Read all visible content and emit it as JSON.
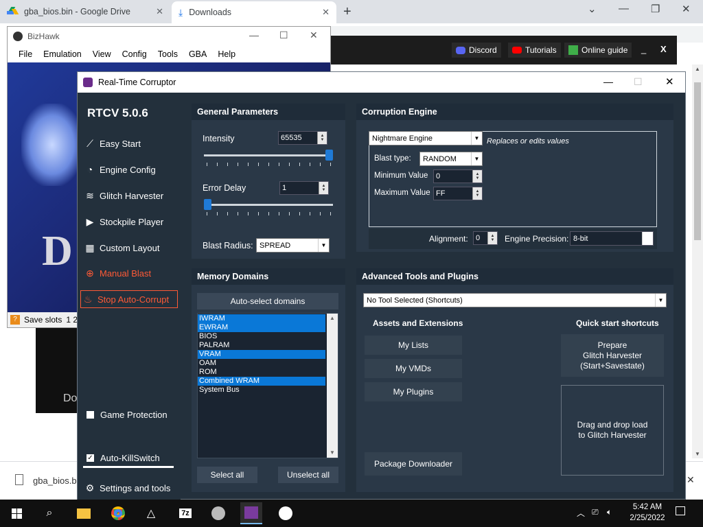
{
  "chrome": {
    "tab1_title": "gba_bios.bin - Google Drive",
    "tab2_title": "Downloads",
    "tab_close": "✕",
    "new_tab": "+",
    "minimize": "⌄",
    "restore": "—",
    "maximize": "❐",
    "close": "✕"
  },
  "banner": {
    "discord": "Discord",
    "tutorials": "Tutorials",
    "online_guide": "Online guide",
    "minimize": "_",
    "close": "X"
  },
  "downloads_bar": {
    "file_name": "gba_bios.bi"
  },
  "background_game": {
    "partial_text": "Do"
  },
  "bizhawk": {
    "title": "BizHawk",
    "menu": [
      "File",
      "Emulation",
      "View",
      "Config",
      "Tools",
      "GBA",
      "Help"
    ],
    "status_label": "Save slots",
    "status_slots": "1  2",
    "game_letter": "D"
  },
  "rtc": {
    "title": "Real-Time Corruptor",
    "version": "RTCV 5.0.6",
    "sidebar": {
      "easy_start": "Easy Start",
      "engine_config": "Engine Config",
      "glitch_harvester": "Glitch Harvester",
      "stockpile_player": "Stockpile Player",
      "custom_layout": "Custom Layout",
      "manual_blast": "Manual Blast",
      "stop_auto_corrupt": "Stop Auto-Corrupt",
      "game_protection": "Game Protection",
      "auto_killswitch": "Auto-KillSwitch",
      "settings_and_tools": "Settings and tools"
    },
    "general": {
      "title": "General Parameters",
      "intensity_label": "Intensity",
      "intensity_value": "65535",
      "intensity_level": 1.0,
      "error_delay_label": "Error Delay",
      "error_delay_value": "1",
      "error_delay_level": 0.0,
      "blast_radius_label": "Blast Radius:",
      "blast_radius_value": "SPREAD"
    },
    "engine": {
      "title": "Corruption Engine",
      "engine_value": "Nightmare Engine",
      "engine_desc": "Replaces or edits values",
      "blast_type_label": "Blast type:",
      "blast_type_value": "RANDOM",
      "min_label": "Minimum Value",
      "min_value": "0",
      "max_label": "Maximum Value",
      "max_value": "FF",
      "alignment_label": "Alignment:",
      "alignment_value": "0",
      "precision_label": "Engine Precision:",
      "precision_value": "8-bit"
    },
    "memory": {
      "title": "Memory Domains",
      "auto_select": "Auto-select domains",
      "domains": [
        {
          "name": "IWRAM",
          "selected": true
        },
        {
          "name": "EWRAM",
          "selected": true
        },
        {
          "name": "BIOS",
          "selected": false
        },
        {
          "name": "PALRAM",
          "selected": false
        },
        {
          "name": "VRAM",
          "selected": true
        },
        {
          "name": "OAM",
          "selected": false
        },
        {
          "name": "ROM",
          "selected": false
        },
        {
          "name": "Combined WRAM",
          "selected": true
        },
        {
          "name": "System Bus",
          "selected": false
        }
      ],
      "select_all": "Select all",
      "unselect_all": "Unselect all"
    },
    "advanced": {
      "title": "Advanced Tools and Plugins",
      "tool_select": "No Tool Selected (Shortcuts)",
      "assets_title": "Assets and Extensions",
      "my_lists": "My Lists",
      "my_vmds": "My VMDs",
      "my_plugins": "My Plugins",
      "package_downloader": "Package Downloader",
      "quick_title": "Quick start shortcuts",
      "prepare_gh": "Prepare\nGlitch Harvester\n(Start+Savestate)",
      "drag_drop": "Drag and drop load\nto Glitch Harvester"
    }
  },
  "taskbar": {
    "time": "5:42 AM",
    "date": "2/25/2022",
    "app_7z": "7z"
  },
  "colors": {
    "rtc_bg": "#23303c",
    "panel": "#2a3847",
    "accent_red": "#ff5a36",
    "selection_blue": "#0a78d7"
  }
}
